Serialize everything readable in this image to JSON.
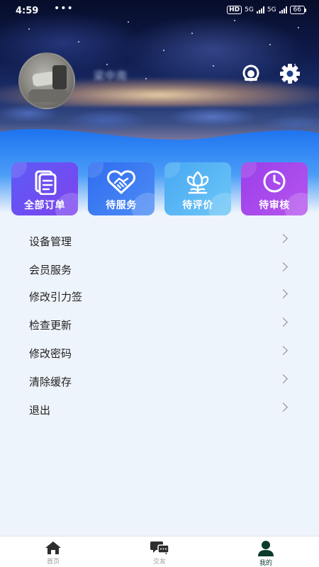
{
  "status_bar": {
    "time": "4:59",
    "dots": "•••",
    "hd": "HD",
    "network_1": "5G",
    "network_2": "5G",
    "battery": "66"
  },
  "profile": {
    "username": "梁中南",
    "icons": [
      "support-icon",
      "settings-gear-icon"
    ]
  },
  "quick_actions": [
    {
      "label": "全部订单",
      "icon": "document-icon",
      "color": "#6b4cf0"
    },
    {
      "label": "待服务",
      "icon": "heart-handshake-icon",
      "color": "#3f79f3"
    },
    {
      "label": "待评价",
      "icon": "flower-icon",
      "color": "#58b8f4"
    },
    {
      "label": "待审核",
      "icon": "clock-icon",
      "color": "#a249ec"
    }
  ],
  "menu": [
    {
      "label": "设备管理"
    },
    {
      "label": "会员服务"
    },
    {
      "label": "修改引力签"
    },
    {
      "label": "检查更新"
    },
    {
      "label": "修改密码"
    },
    {
      "label": "清除缓存"
    },
    {
      "label": "退出"
    }
  ],
  "bottom_nav": [
    {
      "label": "首页",
      "icon": "home-icon",
      "active": false
    },
    {
      "label": "交友",
      "icon": "chat-icon",
      "active": false
    },
    {
      "label": "我的",
      "icon": "person-icon",
      "active": true
    }
  ]
}
